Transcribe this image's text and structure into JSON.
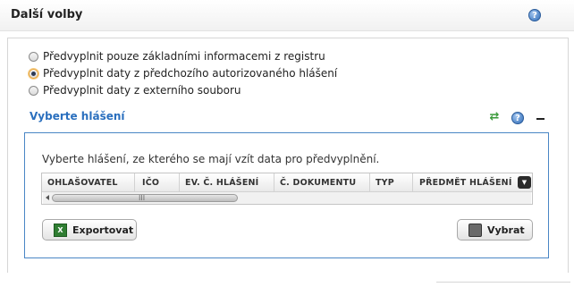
{
  "panel": {
    "title": "Další volby",
    "help_icon": "help-icon",
    "collapse_icon": "minus-icon"
  },
  "options": {
    "selected_index": 1,
    "items": [
      {
        "label": "Předvyplnit pouze základními informacemi z registru"
      },
      {
        "label": "Předvyplnit daty z předchozího autorizovaného hlášení"
      },
      {
        "label": "Předvyplnit daty z externího souboru"
      }
    ]
  },
  "section": {
    "title": "Vyberte hlášení",
    "refresh_icon": "refresh-icon",
    "help_icon": "help-icon",
    "collapse_icon": "minus-icon",
    "instruction": "Vyberte hlášení, ze kterého se mají vzít data pro předvyplnění.",
    "grid": {
      "columns": [
        "OHLAŠOVATEL",
        "IČO",
        "EV. Č. HLÁŠENÍ",
        "Č. DOKUMENTU",
        "TYP",
        "PŘEDMĚT HLÁŠENÍ"
      ],
      "rows": [],
      "column_menu_icon": "column-menu-icon",
      "scroll_grip": "III"
    },
    "buttons": {
      "export": {
        "label": "Exportovat",
        "icon": "excel-icon"
      },
      "select": {
        "label": "Vybrat",
        "icon": "select-icon"
      }
    }
  },
  "colors": {
    "section_title": "#2a6fbe",
    "inner_border": "#4a86c5",
    "radio_selected_ring": "#e8a43a"
  }
}
